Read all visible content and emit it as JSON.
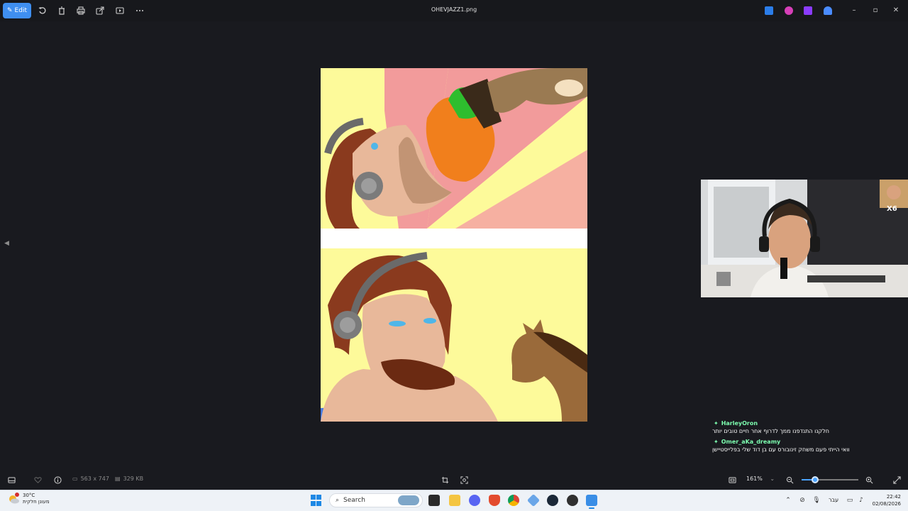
{
  "toolbar": {
    "edit_label": "Edit",
    "file_title": "OHEVJAZZ1.png"
  },
  "webcam": {
    "badge": "X6"
  },
  "chat": {
    "messages": [
      {
        "user": "HarleyOron",
        "text": "חלקנו התנדפנו ממך לדרוף אחר חיים טובים יותר"
      },
      {
        "user": "Omer_aKa_dreamy",
        "text": "וואי הייתי פעם משחק זינובורס עם בן דוד שלי בפלייסטיישן"
      }
    ]
  },
  "status": {
    "dimensions": "563 x 747",
    "file_size": "329 KB",
    "zoom": "161%",
    "zoom_level": 0.24
  },
  "taskbar": {
    "weather_temp": "30°C",
    "weather_desc": "מעונן חלקית",
    "search_placeholder": "Search",
    "language": "עבר",
    "time": "22:42",
    "date": "02/08/2026"
  },
  "colors": {
    "accent": "#3f8ff0",
    "chat_user": "#7dffb0",
    "canvas_bg": "#fdfa9a"
  }
}
